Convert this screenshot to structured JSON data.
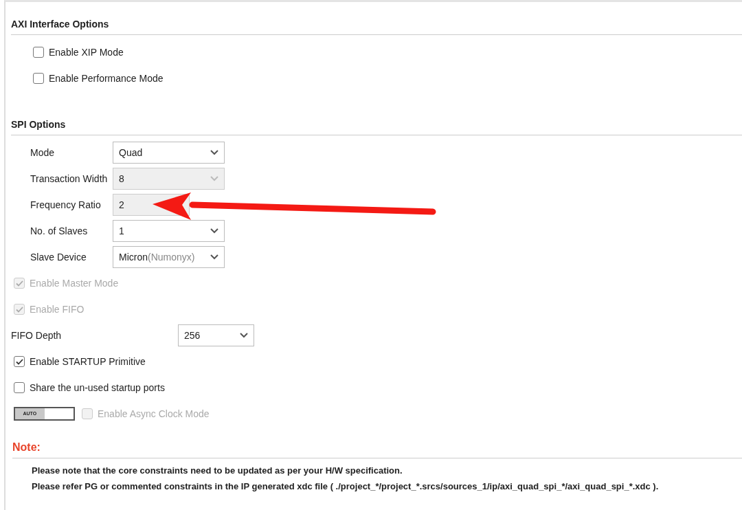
{
  "axi_section": {
    "title": "AXI Interface Options",
    "options": [
      {
        "label": "Enable XIP Mode",
        "checked": false,
        "disabled": false
      },
      {
        "label": "Enable Performance Mode",
        "checked": false,
        "disabled": false
      }
    ]
  },
  "spi_section": {
    "title": "SPI Options",
    "params": [
      {
        "kind": "select",
        "label": "Mode",
        "value": "Quad",
        "disabled": false
      },
      {
        "kind": "select",
        "label": "Transaction Width",
        "value": "8",
        "disabled": true
      },
      {
        "kind": "short",
        "label": "Frequency Ratio",
        "value": "2",
        "disabled": true
      },
      {
        "kind": "select",
        "label": "No. of Slaves",
        "value": "1",
        "disabled": false
      },
      {
        "kind": "select",
        "label": "Slave Device",
        "value": "Micron",
        "value_note": "(Numonyx)",
        "disabled": false
      }
    ],
    "options": [
      {
        "kind": "check",
        "label": "Enable Master Mode",
        "checked": true,
        "disabled": true
      },
      {
        "kind": "check",
        "label": "Enable FIFO",
        "checked": true,
        "disabled": true
      },
      {
        "kind": "select",
        "label": "FIFO Depth",
        "value": "256",
        "disabled": false
      },
      {
        "kind": "check",
        "label": "Enable STARTUP Primitive",
        "checked": true,
        "disabled": false
      },
      {
        "kind": "check",
        "label": "Share the un-used startup ports",
        "checked": false,
        "disabled": false
      },
      {
        "kind": "auto",
        "toggle": "AUTO",
        "label": "Enable Async Clock Mode",
        "checked": false,
        "disabled": true
      }
    ]
  },
  "note": {
    "title": "Note:",
    "lines": [
      "Please note that the core constraints need to be updated as per your H/W specification.",
      "Please refer PG or commented constraints in the IP generated xdc file ( ./project_*/project_*.srcs/sources_1/ip/axi_quad_spi_*/axi_quad_spi_*.xdc )."
    ]
  }
}
